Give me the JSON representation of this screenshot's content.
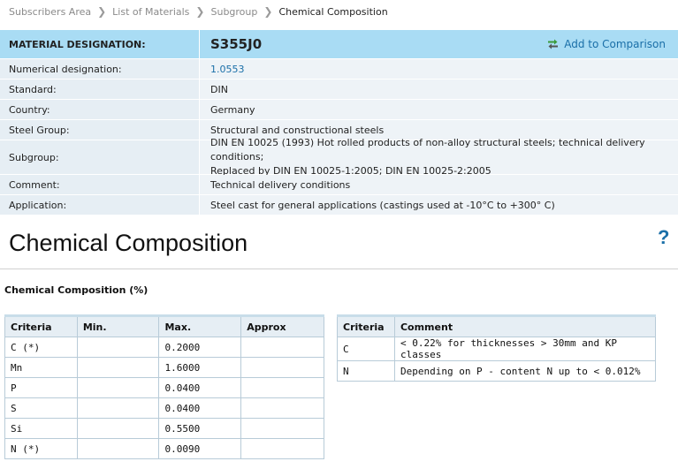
{
  "breadcrumb": {
    "items": [
      "Subscribers Area",
      "List of Materials",
      "Subgroup"
    ],
    "current": "Chemical Composition"
  },
  "header": {
    "label": "MATERIAL DESIGNATION:",
    "designation": "S355J0",
    "compare_label": "Add to Comparison"
  },
  "info_rows": [
    {
      "label": "Numerical designation:",
      "value": "1.0553"
    },
    {
      "label": "Standard:",
      "value": "DIN"
    },
    {
      "label": "Country:",
      "value": "Germany"
    },
    {
      "label": "Steel Group:",
      "value": "Structural and constructional steels"
    },
    {
      "label": "Subgroup:",
      "value_line1": "DIN EN 10025 (1993) Hot rolled products of non-alloy structural steels; technical delivery conditions;",
      "value_line2": "Replaced by DIN EN 10025-1:2005; DIN EN 10025-2:2005"
    },
    {
      "label": "Comment:",
      "value": "Technical delivery conditions"
    },
    {
      "label": "Application:",
      "value": "Steel cast for general applications (castings used at -10°C to +300° C)"
    }
  ],
  "section_title": "Chemical Composition",
  "subsection_title": "Chemical Composition (%)",
  "composition_table": {
    "headers": [
      "Criteria",
      "Min.",
      "Max.",
      "Approx"
    ],
    "rows": [
      [
        "C (*)",
        "",
        "0.2000",
        ""
      ],
      [
        "Mn",
        "",
        "1.6000",
        ""
      ],
      [
        "P",
        "",
        "0.0400",
        ""
      ],
      [
        "S",
        "",
        "0.0400",
        ""
      ],
      [
        "Si",
        "",
        "0.5500",
        ""
      ],
      [
        "N (*)",
        "",
        "0.0090",
        ""
      ]
    ]
  },
  "comment_table": {
    "headers": [
      "Criteria",
      "Comment"
    ],
    "rows": [
      [
        "C",
        "< 0.22% for thicknesses > 30mm and KP classes"
      ],
      [
        "N",
        "Depending on P - content N up to < 0.012%"
      ]
    ]
  },
  "icons": {
    "compare": "swap-arrows-icon",
    "help": "help-icon",
    "separator": "chevron-right-icon"
  },
  "colors": {
    "header_bg": "#a9dcf4",
    "row_bg": "#e6eef4",
    "link": "#1a6fa8"
  }
}
